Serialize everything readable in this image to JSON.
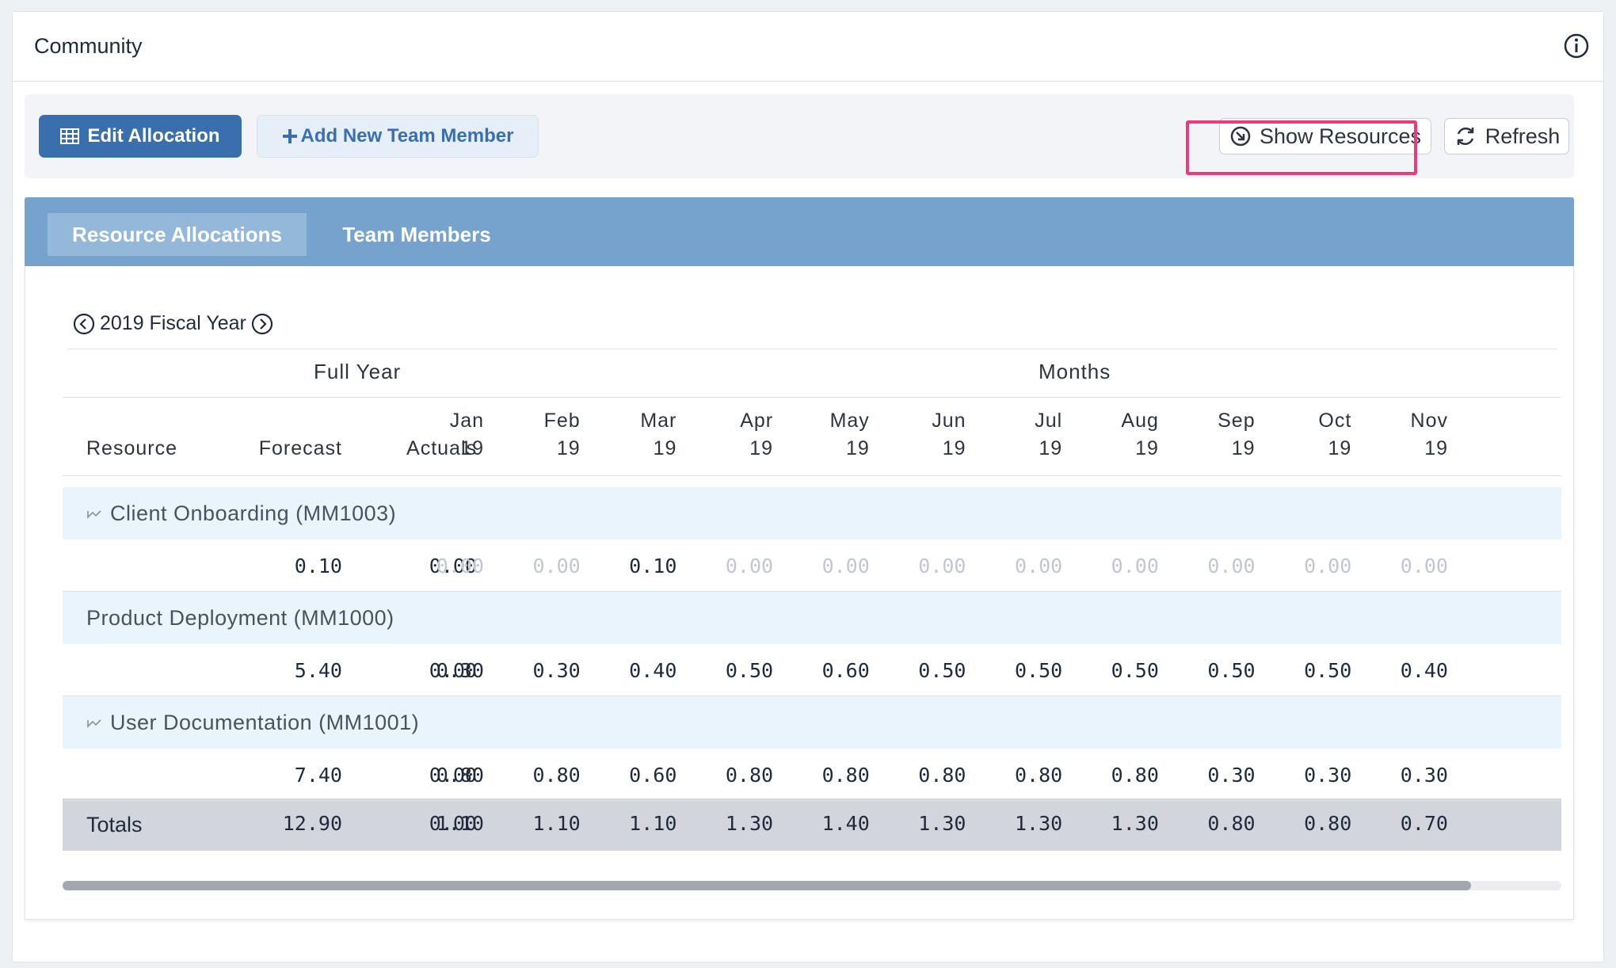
{
  "card": {
    "title": "Community"
  },
  "toolbar": {
    "edit_label": "Edit Allocation",
    "add_label": "Add New Team Member",
    "show_resources_label": "Show Resources",
    "refresh_label": "Refresh"
  },
  "tabs": [
    {
      "label": "Resource Allocations",
      "active": true
    },
    {
      "label": "Team Members",
      "active": false
    }
  ],
  "fiscal_year": {
    "label": "2019 Fiscal Year"
  },
  "table": {
    "group_headers": {
      "full_year": "Full Year",
      "months": "Months"
    },
    "columns": {
      "resource": "Resource",
      "forecast": "Forecast",
      "actuals": "Actuals",
      "months": [
        {
          "m": "Jan",
          "y": "19"
        },
        {
          "m": "Feb",
          "y": "19"
        },
        {
          "m": "Mar",
          "y": "19"
        },
        {
          "m": "Apr",
          "y": "19"
        },
        {
          "m": "May",
          "y": "19"
        },
        {
          "m": "Jun",
          "y": "19"
        },
        {
          "m": "Jul",
          "y": "19"
        },
        {
          "m": "Aug",
          "y": "19"
        },
        {
          "m": "Sep",
          "y": "19"
        },
        {
          "m": "Oct",
          "y": "19"
        },
        {
          "m": "Nov",
          "y": "19"
        }
      ]
    },
    "projects": [
      {
        "name": "Client Onboarding (MM1003)",
        "icon": "trend-icon",
        "forecast": "0.10",
        "actuals": "0.00",
        "months": [
          "0.00",
          "0.00",
          "0.10",
          "0.00",
          "0.00",
          "0.00",
          "0.00",
          "0.00",
          "0.00",
          "0.00",
          "0.00"
        ],
        "muted": [
          true,
          true,
          false,
          true,
          true,
          true,
          true,
          true,
          true,
          true,
          true
        ]
      },
      {
        "name": "Product Deployment (MM1000)",
        "icon": "",
        "forecast": "5.40",
        "actuals": "0.00",
        "months": [
          "0.30",
          "0.30",
          "0.40",
          "0.50",
          "0.60",
          "0.50",
          "0.50",
          "0.50",
          "0.50",
          "0.50",
          "0.40"
        ],
        "muted": [
          false,
          false,
          false,
          false,
          false,
          false,
          false,
          false,
          false,
          false,
          false
        ]
      },
      {
        "name": "User Documentation (MM1001)",
        "icon": "trend-icon",
        "forecast": "7.40",
        "actuals": "0.00",
        "months": [
          "0.80",
          "0.80",
          "0.60",
          "0.80",
          "0.80",
          "0.80",
          "0.80",
          "0.80",
          "0.30",
          "0.30",
          "0.30"
        ],
        "muted": [
          false,
          false,
          false,
          false,
          false,
          false,
          false,
          false,
          false,
          false,
          false
        ]
      }
    ],
    "totals": {
      "label": "Totals",
      "forecast": "12.90",
      "actuals": "0.00",
      "months": [
        "1.10",
        "1.10",
        "1.10",
        "1.30",
        "1.40",
        "1.30",
        "1.30",
        "1.30",
        "0.80",
        "0.80",
        "0.70"
      ]
    },
    "scroll_position": 0.94
  },
  "colors": {
    "primary": "#3a6fae",
    "tabbar": "#75a3cd",
    "highlight": "#ec3a7b",
    "project_band": "#eaf4fc",
    "totals_band": "#d2d6dc"
  }
}
